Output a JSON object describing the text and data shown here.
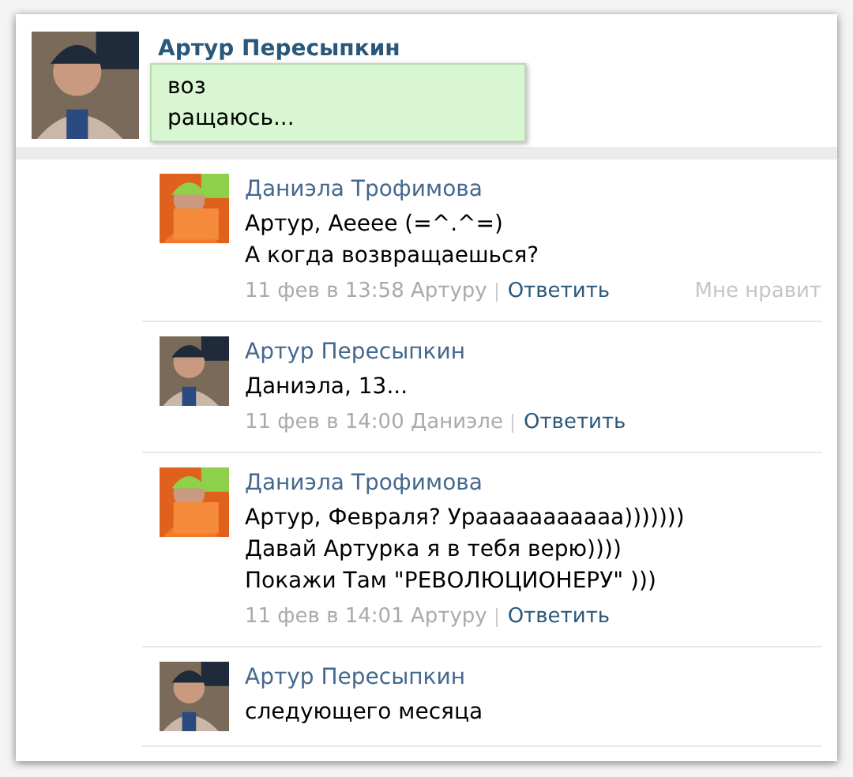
{
  "post": {
    "author": "Артур Пересыпкин",
    "status_lines": [
      "воз",
      "ращаюсь..."
    ]
  },
  "comments": [
    {
      "author": "Даниэла Трофимова",
      "lines": [
        "Артур, Аееее (=^.^=)",
        "А когда возвращаешься?"
      ],
      "date": "11 фев в 13:58",
      "reply_to": "Артуру",
      "reply_link": "Ответить",
      "like": "Мне нравит"
    },
    {
      "author": "Артур Пересыпкин",
      "lines": [
        "Даниэла, 13..."
      ],
      "date": "11 фев в 14:00",
      "reply_to": "Даниэле",
      "reply_link": "Ответить"
    },
    {
      "author": "Даниэла Трофимова",
      "lines": [
        "Артур, Февраля? Урааааааааааа)))))))",
        "Давай Артурка я в тебя верю))))",
        "Покажи Там \"РЕВОЛЮЦИОНЕРУ\" )))"
      ],
      "date": "11 фев в 14:01",
      "reply_to": "Артуру",
      "reply_link": "Ответить"
    },
    {
      "author": "Артур Пересыпкин",
      "lines": [
        "следующего месяца"
      ]
    }
  ]
}
